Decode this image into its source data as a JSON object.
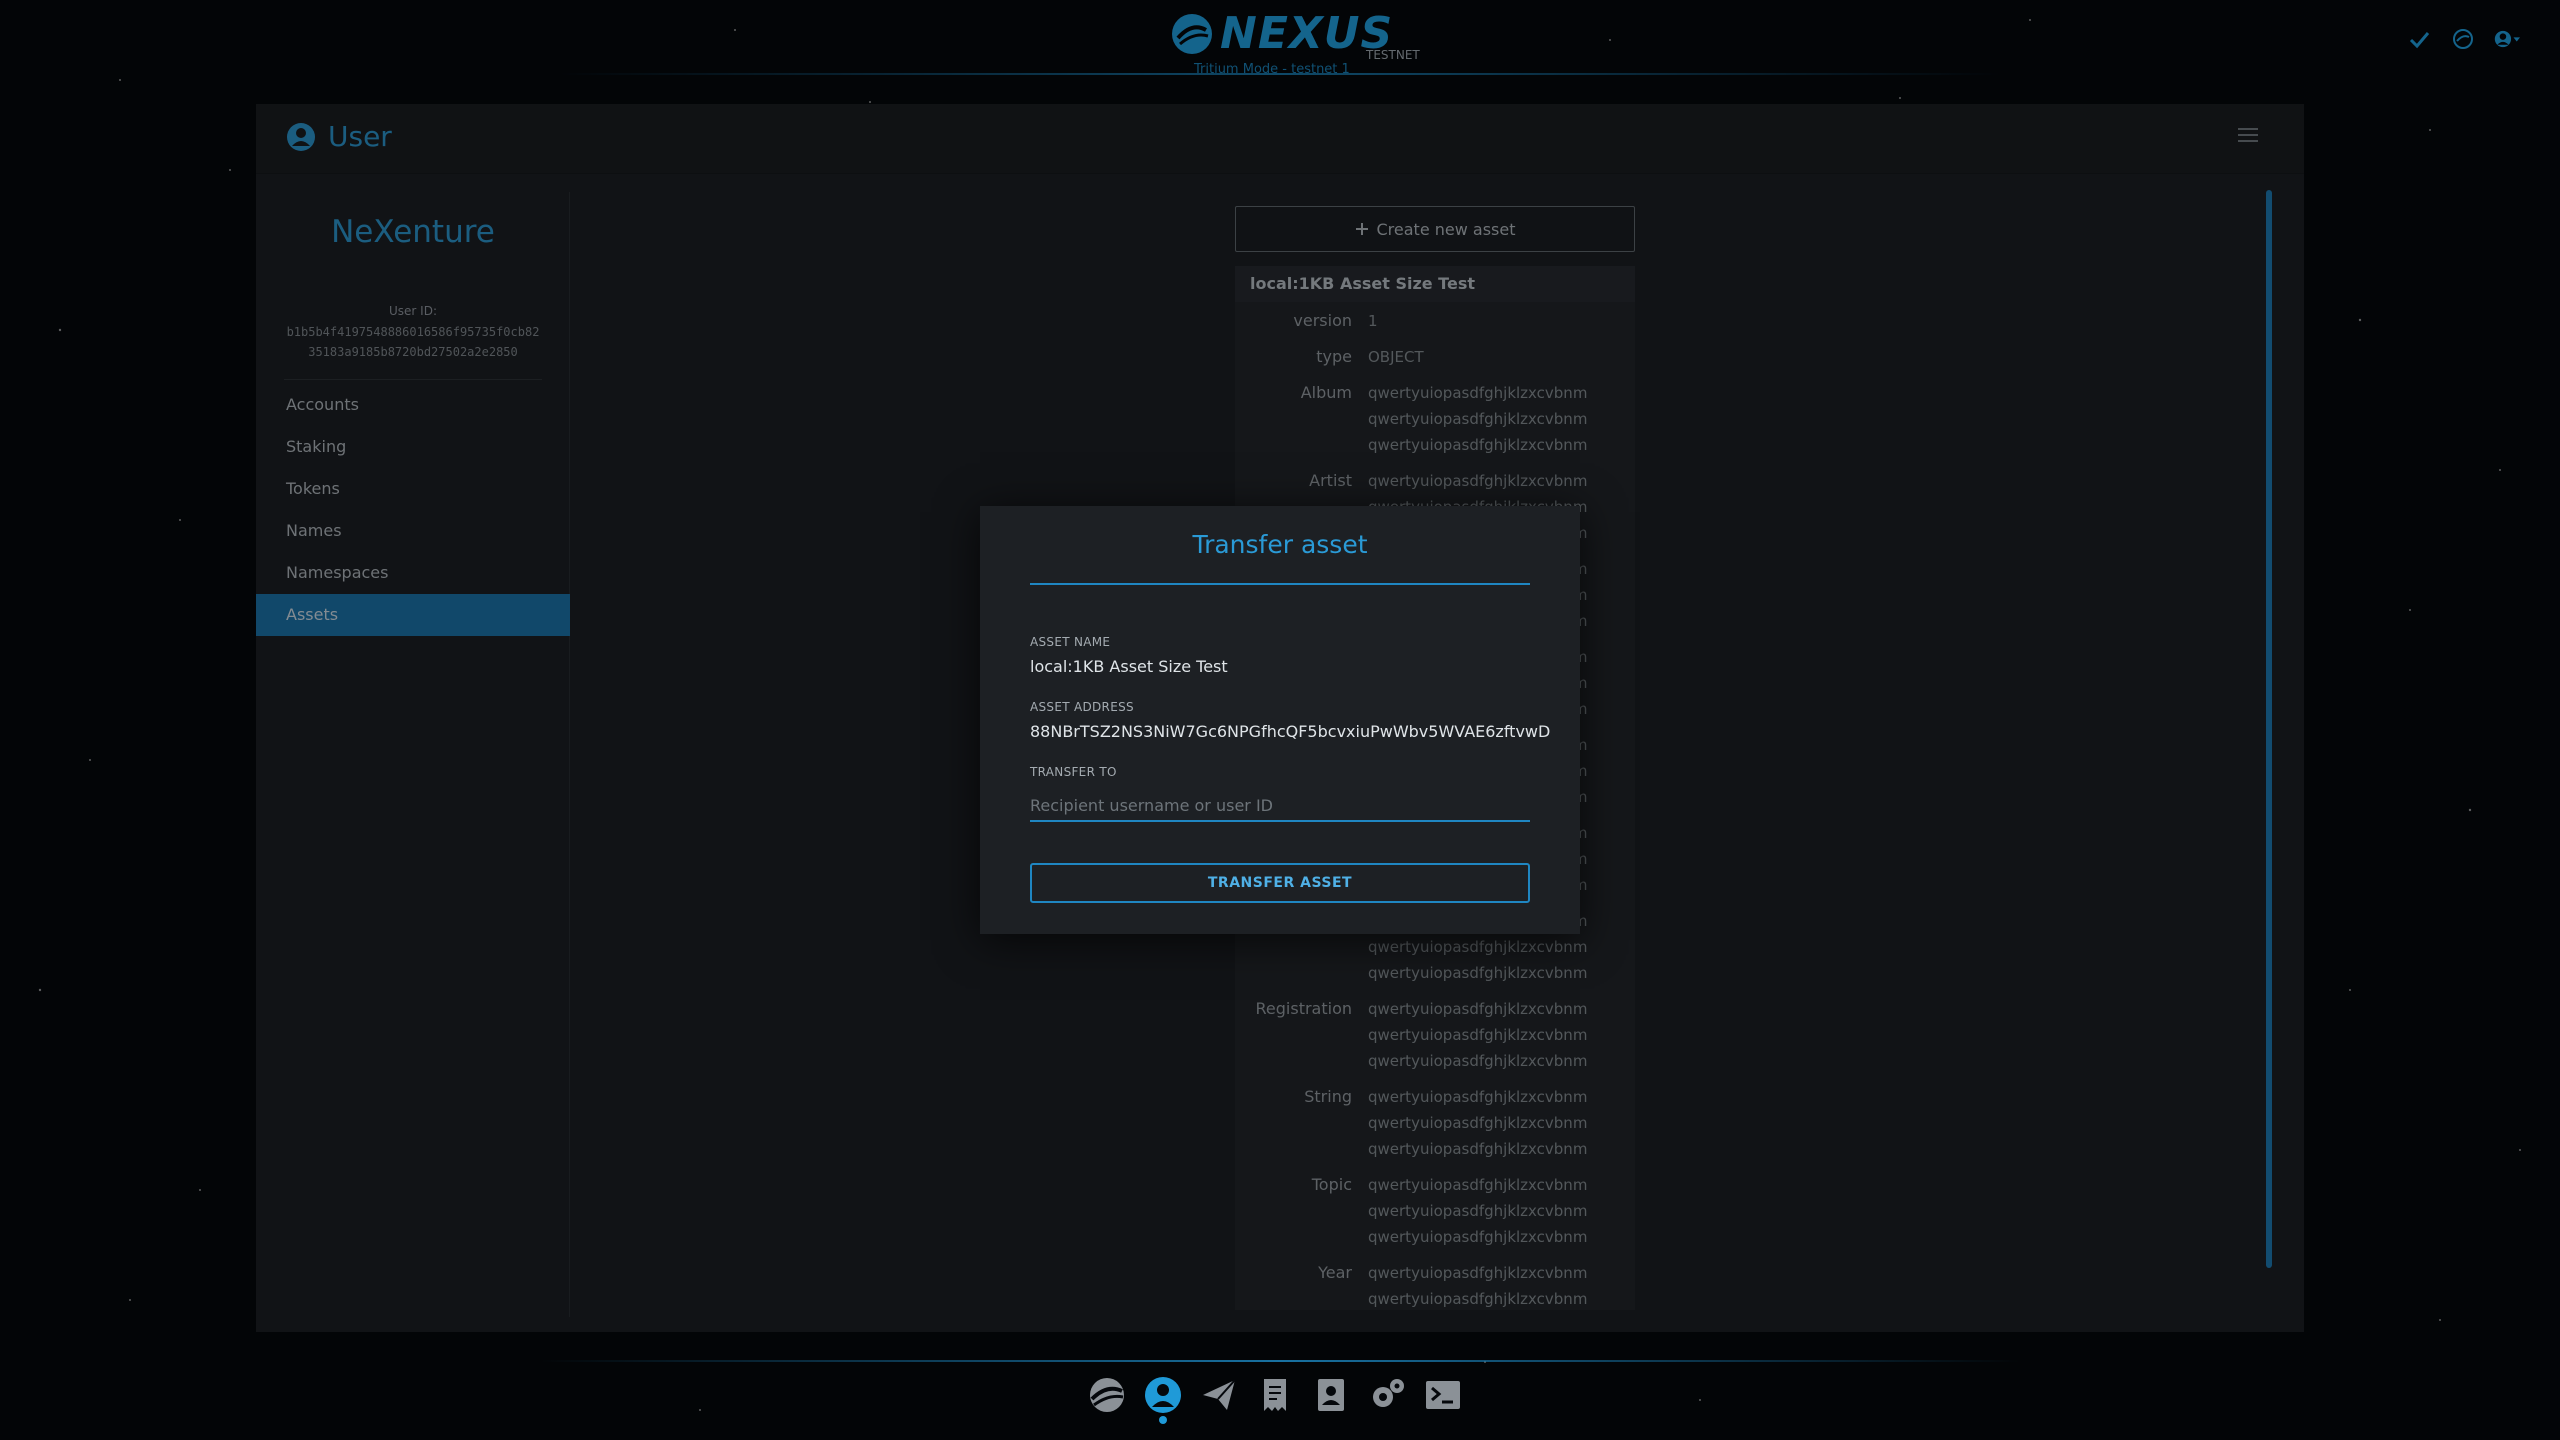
{
  "header": {
    "logo_text": "NEXUS",
    "network_badge": "TESTNET",
    "mode_label": "Tritium Mode - testnet 1"
  },
  "panel": {
    "title": "User"
  },
  "sidebar": {
    "username": "NeXenture",
    "user_id_label": "User ID:",
    "user_id": "b1b5b4f4197548886016586f95735f0cb8235183a9185b8720bd27502a2e2850",
    "items": [
      {
        "label": "Accounts",
        "active": false
      },
      {
        "label": "Staking",
        "active": false
      },
      {
        "label": "Tokens",
        "active": false
      },
      {
        "label": "Names",
        "active": false
      },
      {
        "label": "Namespaces",
        "active": false
      },
      {
        "label": "Assets",
        "active": true
      }
    ]
  },
  "content": {
    "create_button": "Create new asset",
    "asset": {
      "title": "local:1KB Asset Size Test",
      "fields": [
        {
          "key": "version",
          "values": [
            "1"
          ]
        },
        {
          "key": "type",
          "values": [
            "OBJECT"
          ]
        },
        {
          "key": "Album",
          "values": [
            "qwertyuiopasdfghjklzxcvbnm",
            "qwertyuiopasdfghjklzxcvbnm",
            "qwertyuiopasdfghjklzxcvbnm"
          ]
        },
        {
          "key": "Artist",
          "values": [
            "qwertyuiopasdfghjklzxcvbnm",
            "qwertyuiopasdfghjklzxcvbnm",
            "qwertyuiopasdfghjklzxcvbnm"
          ]
        },
        {
          "key": "",
          "values": [
            "qwertyuiopasdfghjklzxcvbnm",
            "qwertyuiopasdfghjklzxcvbnm",
            "qwertyuiopasdfghjklzxcvbnm"
          ]
        },
        {
          "key": "",
          "values": [
            "qwertyuiopasdfghjklzxcvbnm",
            "qwertyuiopasdfghjklzxcvbnm",
            "qwertyuiopasdfghjklzxcvbnm"
          ]
        },
        {
          "key": "",
          "values": [
            "qwertyuiopasdfghjklzxcvbnm",
            "qwertyuiopasdfghjklzxcvbnm",
            "qwertyuiopasdfghjklzxcvbnm"
          ]
        },
        {
          "key": "",
          "values": [
            "qwertyuiopasdfghjklzxcvbnm",
            "qwertyuiopasdfghjklzxcvbnm",
            "qwertyuiopasdfghjklzxcvbnm"
          ]
        },
        {
          "key": "",
          "values": [
            "qwertyuiopasdfghjklzxcvbnm",
            "qwertyuiopasdfghjklzxcvbnm",
            "qwertyuiopasdfghjklzxcvbnm"
          ]
        },
        {
          "key": "Registration",
          "values": [
            "qwertyuiopasdfghjklzxcvbnm",
            "qwertyuiopasdfghjklzxcvbnm",
            "qwertyuiopasdfghjklzxcvbnm"
          ]
        },
        {
          "key": "String",
          "values": [
            "qwertyuiopasdfghjklzxcvbnm",
            "qwertyuiopasdfghjklzxcvbnm",
            "qwertyuiopasdfghjklzxcvbnm"
          ]
        },
        {
          "key": "Topic",
          "values": [
            "qwertyuiopasdfghjklzxcvbnm",
            "qwertyuiopasdfghjklzxcvbnm",
            "qwertyuiopasdfghjklzxcvbnm"
          ]
        },
        {
          "key": "Year",
          "values": [
            "qwertyuiopasdfghjklzxcvbnm",
            "qwertyuiopasdfghjklzxcvbnm"
          ]
        }
      ]
    }
  },
  "modal": {
    "title": "Transfer asset",
    "asset_name_label": "ASSET NAME",
    "asset_name": "local:1KB Asset Size Test",
    "asset_address_label": "ASSET ADDRESS",
    "asset_address": "88NBrTSZ2NS3NiW7Gc6NPGfhcQF5bcvxiuPwWbv5WVAE6zftvwD",
    "transfer_to_label": "TRANSFER TO",
    "transfer_to_placeholder": "Recipient username or user ID",
    "transfer_to_value": "",
    "submit_label": "TRANSFER ASSET"
  },
  "footer": {
    "icons": [
      "overview-icon",
      "user-icon",
      "send-icon",
      "transactions-icon",
      "address-book-icon",
      "settings-icon",
      "terminal-icon"
    ],
    "active": "user-icon"
  },
  "colors": {
    "accent": "#1f9ad8",
    "active_nav": "#1b6fa3",
    "panel_bg": "#1b1e22",
    "modal_bg": "#1d2024"
  }
}
